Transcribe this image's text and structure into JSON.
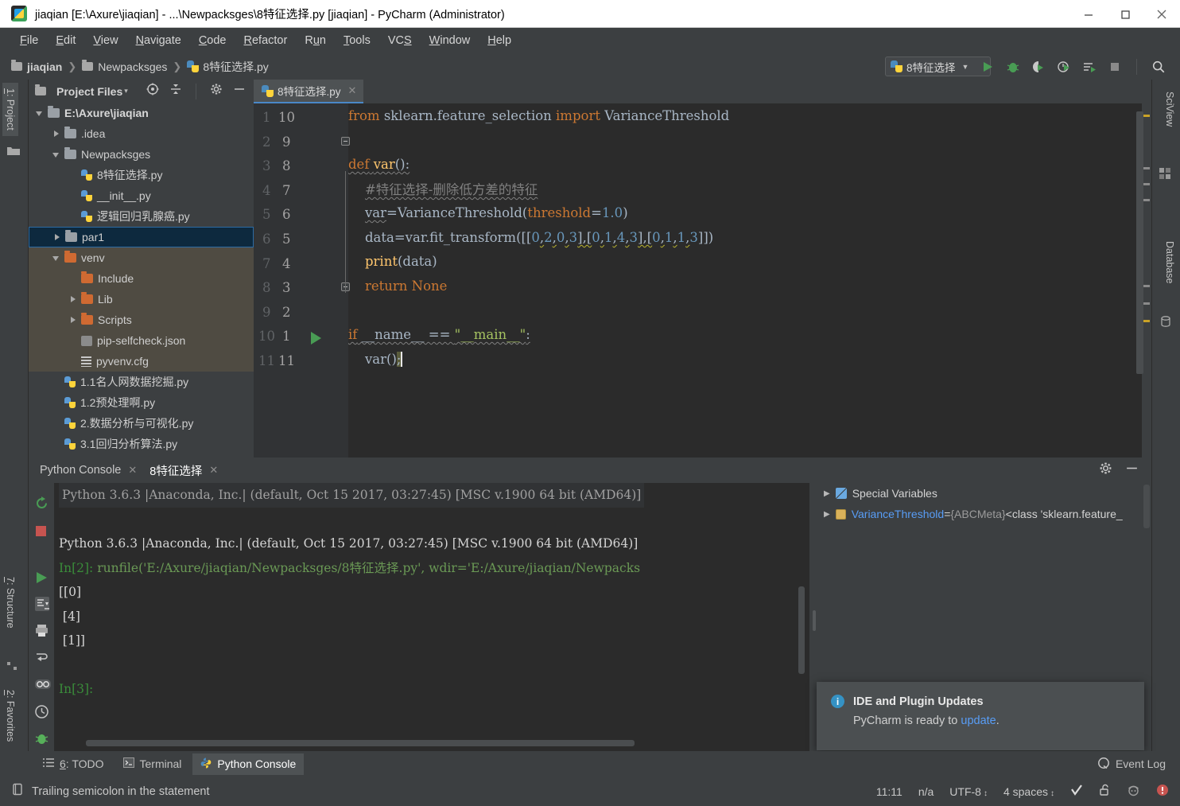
{
  "window": {
    "title": "jiaqian [E:\\Axure\\jiaqian] - ...\\Newpacksges\\8特征选择.py [jiaqian] - PyCharm (Administrator)",
    "app_icon": "pycharm-icon",
    "minimize": "—",
    "maximize": "□",
    "close": "✕"
  },
  "menu": [
    {
      "label": "File",
      "mnemonic": "F"
    },
    {
      "label": "Edit",
      "mnemonic": "E"
    },
    {
      "label": "View",
      "mnemonic": "V"
    },
    {
      "label": "Navigate",
      "mnemonic": "N"
    },
    {
      "label": "Code",
      "mnemonic": "C"
    },
    {
      "label": "Refactor",
      "mnemonic": "R"
    },
    {
      "label": "Run",
      "mnemonic": "u"
    },
    {
      "label": "Tools",
      "mnemonic": "T"
    },
    {
      "label": "VCS",
      "mnemonic": "S"
    },
    {
      "label": "Window",
      "mnemonic": "W"
    },
    {
      "label": "Help",
      "mnemonic": "H"
    }
  ],
  "breadcrumb": [
    {
      "label": "jiaqian",
      "icon": "folder-icon"
    },
    {
      "label": "Newpacksges",
      "icon": "folder-icon"
    },
    {
      "label": "8特征选择.py",
      "icon": "python-file-icon"
    }
  ],
  "toolbar": {
    "run_config": "8特征选择",
    "run_config_caret": "▼",
    "buttons": [
      "run-icon",
      "debug-icon",
      "coverage-icon",
      "profile-icon",
      "run-with-console-icon",
      "stop-icon",
      "search-everywhere-icon"
    ]
  },
  "left_strip": {
    "tabs": [
      {
        "label": "1: Project",
        "mnemonic": "1",
        "selected": true
      },
      {
        "label": "7: Structure",
        "mnemonic": "7",
        "selected": false
      },
      {
        "label": "2: Favorites",
        "mnemonic": "2",
        "selected": false
      }
    ]
  },
  "right_strip": {
    "tabs": [
      {
        "label": "SciView"
      },
      {
        "label": "Database"
      }
    ]
  },
  "project_panel": {
    "title": "Project Files",
    "title_caret": "▾",
    "header_icons": [
      "locate-icon",
      "collapse-all-icon",
      "settings-gear-icon",
      "hide-icon"
    ],
    "tree": [
      {
        "label": "E:\\Axure\\jiaqian",
        "depth": 0,
        "arrow": "down",
        "icon": "folder-icon",
        "bold": true,
        "selected": false,
        "highlight": false
      },
      {
        "label": ".idea",
        "depth": 1,
        "arrow": "right",
        "icon": "folder-icon",
        "bold": false,
        "selected": false,
        "highlight": false
      },
      {
        "label": "Newpacksges",
        "depth": 1,
        "arrow": "down",
        "icon": "folder-icon",
        "bold": false,
        "selected": false,
        "highlight": false
      },
      {
        "label": "8特征选择.py",
        "depth": 2,
        "arrow": "none",
        "icon": "python-file-icon",
        "bold": false,
        "selected": false,
        "highlight": false
      },
      {
        "label": "__init__.py",
        "depth": 2,
        "arrow": "none",
        "icon": "python-file-icon",
        "bold": false,
        "selected": false,
        "highlight": false
      },
      {
        "label": "逻辑回归乳腺癌.py",
        "depth": 2,
        "arrow": "none",
        "icon": "python-file-icon",
        "bold": false,
        "selected": false,
        "highlight": false
      },
      {
        "label": "par1",
        "depth": 1,
        "arrow": "right",
        "icon": "folder-icon",
        "bold": false,
        "selected": true,
        "highlight": false
      },
      {
        "label": "venv",
        "depth": 1,
        "arrow": "down",
        "icon": "folder-orange-icon",
        "bold": false,
        "selected": false,
        "highlight": true
      },
      {
        "label": "Include",
        "depth": 2,
        "arrow": "none",
        "icon": "folder-orange-icon",
        "bold": false,
        "selected": false,
        "highlight": true
      },
      {
        "label": "Lib",
        "depth": 2,
        "arrow": "right",
        "icon": "folder-orange-icon",
        "bold": false,
        "selected": false,
        "highlight": true
      },
      {
        "label": "Scripts",
        "depth": 2,
        "arrow": "right",
        "icon": "folder-orange-icon",
        "bold": false,
        "selected": false,
        "highlight": true
      },
      {
        "label": "pip-selfcheck.json",
        "depth": 2,
        "arrow": "none",
        "icon": "json-file-icon",
        "bold": false,
        "selected": false,
        "highlight": true
      },
      {
        "label": "pyvenv.cfg",
        "depth": 2,
        "arrow": "none",
        "icon": "config-file-icon",
        "bold": false,
        "selected": false,
        "highlight": true
      },
      {
        "label": "1.1名人网数据挖掘.py",
        "depth": 1,
        "arrow": "none",
        "icon": "python-file-icon",
        "bold": false,
        "selected": false,
        "highlight": false
      },
      {
        "label": "1.2预处理啊.py",
        "depth": 1,
        "arrow": "none",
        "icon": "python-file-icon",
        "bold": false,
        "selected": false,
        "highlight": false
      },
      {
        "label": "2.数据分析与可视化.py",
        "depth": 1,
        "arrow": "none",
        "icon": "python-file-icon",
        "bold": false,
        "selected": false,
        "highlight": false
      },
      {
        "label": "3.1回归分析算法.py",
        "depth": 1,
        "arrow": "none",
        "icon": "python-file-icon",
        "bold": false,
        "selected": false,
        "highlight": false
      }
    ]
  },
  "editor": {
    "tab": {
      "label": "8特征选择.py",
      "close": "✕",
      "icon": "python-file-icon"
    },
    "lines": [
      {
        "n": 1,
        "rel": 10,
        "text": "from sklearn.feature_selection import VarianceThreshold"
      },
      {
        "n": 2,
        "rel": 9,
        "text": ""
      },
      {
        "n": 3,
        "rel": 8,
        "text": "def var():"
      },
      {
        "n": 4,
        "rel": 7,
        "text": "    #特征选择-删除低方差的特征"
      },
      {
        "n": 5,
        "rel": 6,
        "text": "    var=VarianceThreshold(threshold=1.0)"
      },
      {
        "n": 6,
        "rel": 5,
        "text": "    data=var.fit_transform([[0,2,0,3],[0,1,4,3],[0,1,1,3]])"
      },
      {
        "n": 7,
        "rel": 4,
        "text": "    print(data)"
      },
      {
        "n": 8,
        "rel": 3,
        "text": "    return None"
      },
      {
        "n": 9,
        "rel": 2,
        "text": ""
      },
      {
        "n": 10,
        "rel": 1,
        "text": "if __name__ == \"__main__\":"
      },
      {
        "n": 11,
        "rel": 11,
        "text": "    var();"
      }
    ]
  },
  "console": {
    "tabs": [
      {
        "label": "Python Console",
        "close": "✕",
        "active": false
      },
      {
        "label": "8特征选择",
        "close": "✕",
        "active": true
      }
    ],
    "tools": [
      "settings-gear-icon",
      "hide-icon"
    ],
    "side_buttons": [
      "rerun-icon",
      "stop-icon",
      "execute-icon",
      "scroll-to-end-icon",
      "print-icon",
      "soft-wrap-icon"
    ],
    "output": [
      {
        "text": "Python 3.6.3 |Anaconda, Inc.| (default, Oct 15 2017, 03:27:45) [MSC v.1900 64 bit (AMD64)]",
        "style": "gray-banner"
      },
      {
        "text": "",
        "style": "blank"
      },
      {
        "text": "Python 3.6.3 |Anaconda, Inc.| (default, Oct 15 2017, 03:27:45) [MSC v.1900 64 bit (AMD64)]",
        "style": "white"
      },
      {
        "prompt": "In[2]:",
        "text": " runfile('E:/Axure/jiaqian/Newpacksges/8特征选择.py', wdir='E:/Axure/jiaqian/Newpacks",
        "style": "prompt-run"
      },
      {
        "text": "[[0]",
        "style": "white"
      },
      {
        "text": " [4]",
        "style": "white"
      },
      {
        "text": " [1]]",
        "style": "white"
      },
      {
        "text": "",
        "style": "blank"
      },
      {
        "prompt": "In[3]:",
        "text": "",
        "style": "prompt"
      }
    ]
  },
  "variables": {
    "rows": [
      {
        "arrow": "▶",
        "icon": "special-variables-icon",
        "name": "Special Variables",
        "eq": "",
        "value": "",
        "tail": ""
      },
      {
        "arrow": "▶",
        "icon": "variable-icon",
        "name": "VarianceThreshold",
        "eq": " = ",
        "value": "{ABCMeta}",
        "tail": " <class 'sklearn.feature_"
      }
    ]
  },
  "notification": {
    "icon": "info-icon",
    "icon_glyph": "i",
    "title": "IDE and Plugin Updates",
    "body_prefix": "PyCharm is ready to ",
    "link": "update",
    "body_suffix": "."
  },
  "bottom_bar": {
    "tabs": [
      {
        "label": "6: TODO",
        "mnemonic": "6",
        "icon": "todo-icon",
        "active": false
      },
      {
        "label": "Terminal",
        "icon": "terminal-icon",
        "active": false
      },
      {
        "label": "Python Console",
        "icon": "python-console-icon",
        "active": true
      }
    ],
    "event_log": {
      "label": "Event Log",
      "icon": "event-log-icon"
    }
  },
  "status_bar": {
    "message": "Trailing semicolon in the statement",
    "message_icon": "inspection-icon",
    "caret_position": "11:11",
    "line_separator": "n/a",
    "encoding": "UTF-8",
    "encoding_spin": "↕",
    "indent": "4 spaces",
    "indent_spin": "↕",
    "icons": [
      "checkmark-icon",
      "lock-open-icon",
      "inspections-face-icon",
      "error-badge-icon"
    ]
  },
  "colors": {
    "bg": "#3c3f41",
    "editor_bg": "#2b2b2b",
    "gutter_bg": "#313335",
    "accent_blue": "#4a88c7",
    "keyword_orange": "#cc7832",
    "function_yellow": "#ffc66d",
    "number_blue": "#6897bb",
    "string_green": "#a5c261",
    "comment_gray": "#808080",
    "text": "#a9b7c6",
    "selected_row": "#0d293e",
    "venv_highlight": "#4f4b42",
    "link_blue": "#589df6"
  }
}
